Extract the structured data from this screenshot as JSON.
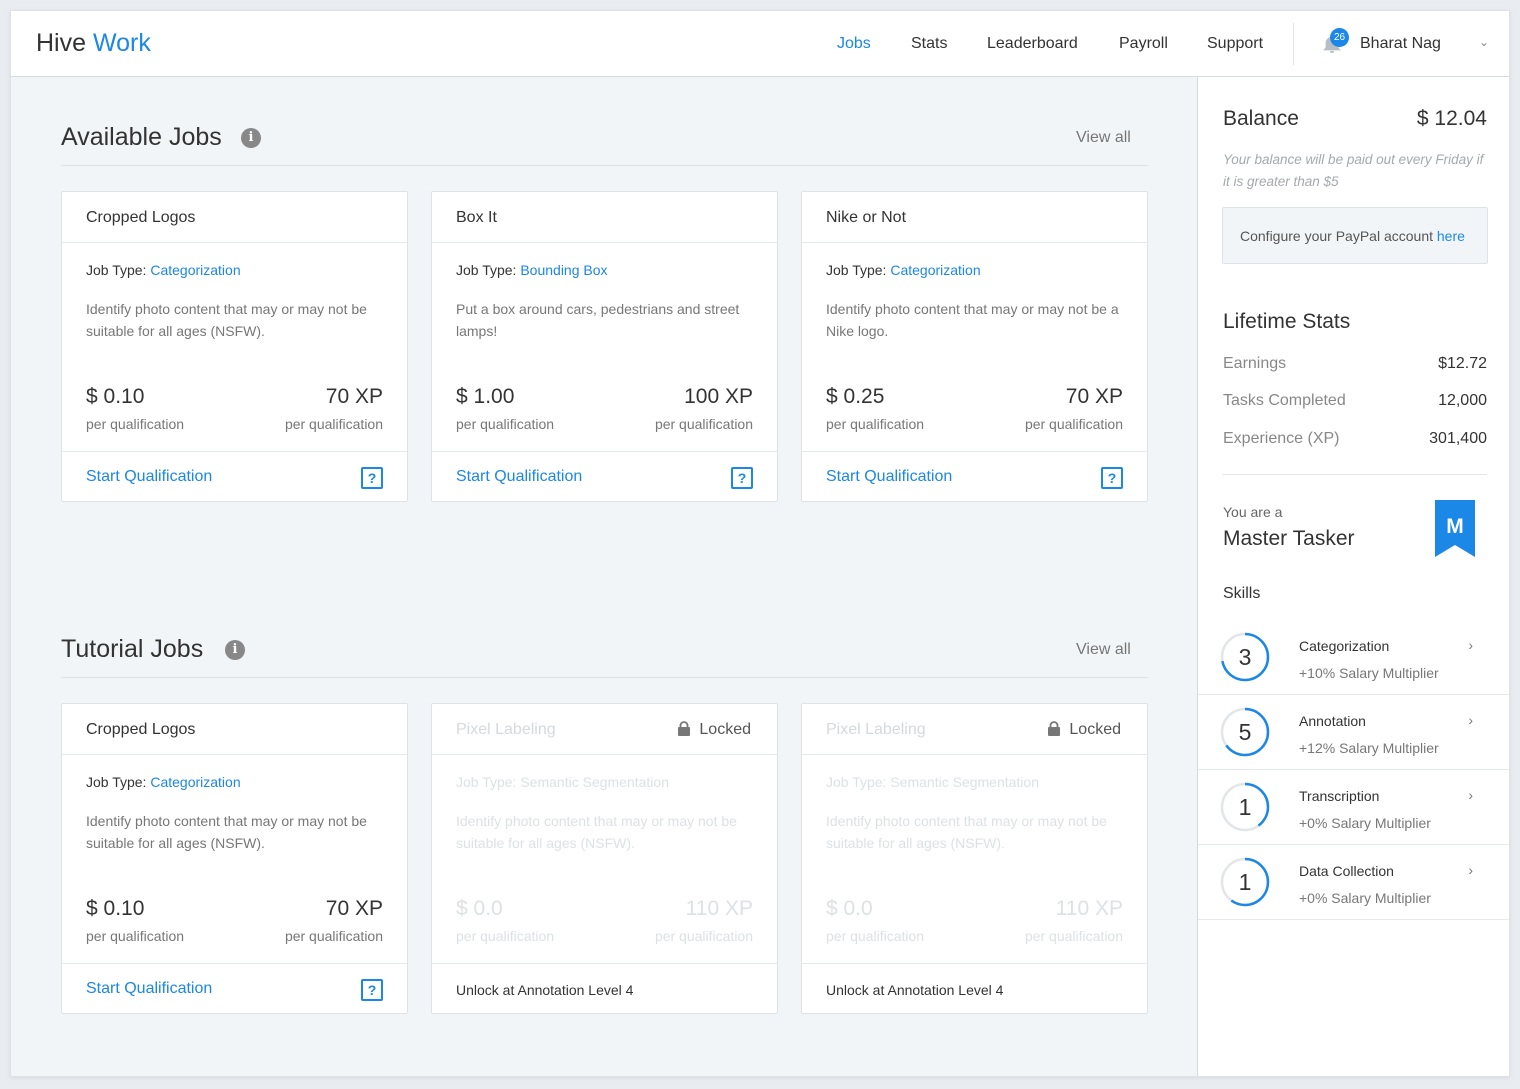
{
  "header": {
    "brand_main": "Hive",
    "brand_accent": "Work",
    "nav": [
      "Jobs",
      "Stats",
      "Leaderboard",
      "Payroll",
      "Support"
    ],
    "active_nav": "Jobs",
    "notification_count": "26",
    "user_name": "Bharat Nag"
  },
  "available": {
    "title": "Available Jobs",
    "view_all": "View all",
    "cards": [
      {
        "title": "Cropped Logos",
        "job_type_label": "Job Type:",
        "job_type": "Categorization",
        "desc": "Identify photo content that may or may not be suitable for all ages (NSFW).",
        "price": "$ 0.10",
        "xp": "70 XP",
        "per_left": "per qualification",
        "per_right": "per qualification",
        "action": "Start Qualification",
        "help": "?"
      },
      {
        "title": "Box It",
        "job_type_label": "Job Type:",
        "job_type": "Bounding Box",
        "desc": "Put a box around cars, pedestrians and street lamps!",
        "price": "$ 1.00",
        "xp": "100 XP",
        "per_left": "per qualification",
        "per_right": "per qualification",
        "action": "Start Qualification",
        "help": "?"
      },
      {
        "title": "Nike or Not",
        "job_type_label": "Job Type:",
        "job_type": "Categorization",
        "desc": "Identify photo content that may or may not be a Nike logo.",
        "price": "$ 0.25",
        "xp": "70 XP",
        "per_left": "per qualification",
        "per_right": "per qualification",
        "action": "Start Qualification",
        "help": "?"
      }
    ]
  },
  "tutorial": {
    "title": "Tutorial Jobs",
    "view_all": "View all",
    "cards": [
      {
        "title": "Cropped Logos",
        "job_type_label": "Job Type:",
        "job_type": "Categorization",
        "desc": "Identify photo content that may or may not be suitable for all ages (NSFW).",
        "price": "$ 0.10",
        "xp": "70 XP",
        "per_left": "per qualification",
        "per_right": "per qualification",
        "action": "Start Qualification",
        "help": "?"
      },
      {
        "title": "Pixel Labeling",
        "lock_label": "Locked",
        "job_type_full": "Job Type: Semantic Segmentation",
        "desc": "Identify photo content that may or may not be suitable for all ages (NSFW).",
        "price": "$ 0.0",
        "xp": "110 XP",
        "per_left": "per qualification",
        "per_right": "per qualification",
        "unlock": "Unlock at Annotation Level 4"
      },
      {
        "title": "Pixel Labeling",
        "lock_label": "Locked",
        "job_type_full": "Job Type: Semantic Segmentation",
        "desc": "Identify photo content that may or may not be suitable for all ages (NSFW).",
        "price": "$ 0.0",
        "xp": "110 XP",
        "per_left": "per qualification",
        "per_right": "per qualification",
        "unlock": "Unlock at Annotation Level 4"
      }
    ]
  },
  "sidebar": {
    "balance_label": "Balance",
    "balance_value": "$ 12.04",
    "balance_note": "Your balance will be paid out every Friday if it is greater than $5",
    "paypal_text": "Configure your PayPal account",
    "paypal_link": "here",
    "lifetime_title": "Lifetime Stats",
    "stats": [
      {
        "label": "Earnings",
        "value": "$12.72"
      },
      {
        "label": "Tasks Completed",
        "value": "12,000"
      },
      {
        "label": "Experience (XP)",
        "value": "301,400"
      }
    ],
    "you_are": "You are a",
    "rank": "Master Tasker",
    "rank_badge": "M",
    "skills_title": "Skills",
    "skills": [
      {
        "level": "3",
        "name": "Categorization",
        "multiplier": "+10% Salary Multiplier",
        "progress": 0.72
      },
      {
        "level": "5",
        "name": "Annotation",
        "multiplier": "+12% Salary Multiplier",
        "progress": 0.65
      },
      {
        "level": "1",
        "name": "Transcription",
        "multiplier": "+0% Salary Multiplier",
        "progress": 0.4
      },
      {
        "level": "1",
        "name": "Data Collection",
        "multiplier": "+0% Salary Multiplier",
        "progress": 0.6
      }
    ]
  },
  "colors": {
    "accent": "#1b87e6",
    "background": "#f2f5f8",
    "card": "#ffffff"
  }
}
